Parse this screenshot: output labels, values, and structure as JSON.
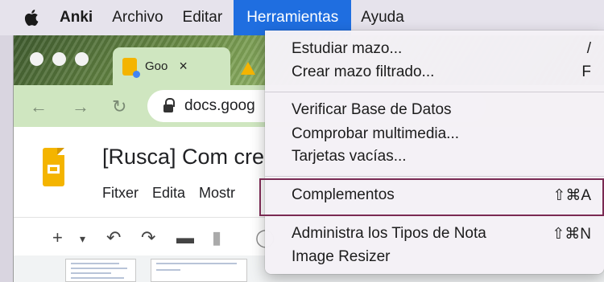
{
  "menubar": {
    "app_name": "Anki",
    "items": [
      "Archivo",
      "Editar",
      "Herramientas",
      "Ayuda"
    ]
  },
  "browser": {
    "tab_title": "Goo",
    "tab_close": "×",
    "url": "docs.goog",
    "doc_title": "[Rusca] Com cre",
    "doc_menu": [
      "Fitxer",
      "Edita",
      "Mostr"
    ]
  },
  "dropdown": {
    "groups": [
      [
        {
          "label": "Estudiar mazo...",
          "shortcut": "/"
        },
        {
          "label": "Crear mazo filtrado...",
          "shortcut": "F"
        }
      ],
      [
        {
          "label": "Verificar Base de Datos",
          "shortcut": ""
        },
        {
          "label": "Comprobar multimedia...",
          "shortcut": ""
        },
        {
          "label": "Tarjetas vacías...",
          "shortcut": ""
        }
      ],
      [
        {
          "label": "Complementos",
          "shortcut": "⇧⌘A"
        }
      ],
      [
        {
          "label": "Administra los Tipos de Nota",
          "shortcut": "⇧⌘N"
        },
        {
          "label": "Image Resizer",
          "shortcut": ""
        }
      ]
    ]
  },
  "colors": {
    "menu_active_bg": "#1f6ee0",
    "highlight_border": "#7a2a53",
    "docs_accent": "#f4b400"
  }
}
